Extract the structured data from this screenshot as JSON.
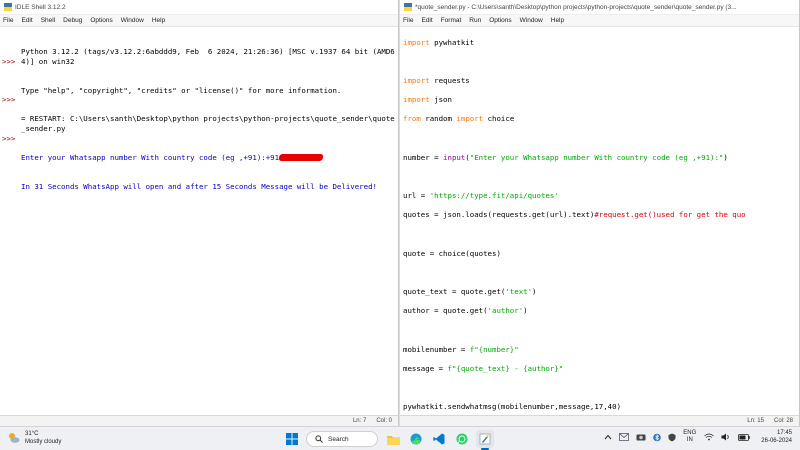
{
  "left_window": {
    "title": "IDLE Shell 3.12.2",
    "menu": [
      "File",
      "Edit",
      "Shell",
      "Debug",
      "Options",
      "Window",
      "Help"
    ],
    "prompts": [
      ">>>",
      ">>>",
      ">>>"
    ],
    "lines": [
      {
        "kind": "out",
        "text": "Python 3.12.2 (tags/v3.12.2:6abddd9, Feb  6 2024, 21:26:36) [MSC v.1937 64 bit (AMD64)] on win32"
      },
      {
        "kind": "out",
        "text": "Type \"help\", \"copyright\", \"credits\" or \"license()\" for more information."
      },
      {
        "kind": "blank",
        "text": ""
      },
      {
        "kind": "out",
        "text": "= RESTART: C:\\Users\\santh\\Desktop\\python projects\\python-projects\\quote_sender\\quote_sender.py"
      },
      {
        "kind": "user",
        "text": "Enter your Whatsapp number With country code (eg ,+91):+91"
      },
      {
        "kind": "user",
        "text": "In 31 Seconds WhatsApp will open and after 15 Seconds Message will be Delivered!"
      }
    ],
    "status": {
      "line": "Ln: 7",
      "col": "Col: 0"
    }
  },
  "right_window": {
    "title": "*quote_sender.py - C:\\Users\\santh\\Desktop\\python projects\\python-projects\\quote_sender\\quote_sender.py (3...",
    "menu": [
      "File",
      "Edit",
      "Format",
      "Run",
      "Options",
      "Window",
      "Help"
    ],
    "code": {
      "l1_kw": "import",
      "l1_rest": " pywhatkit",
      "l3_kw": "import",
      "l3_rest": " requests",
      "l4_kw": "import",
      "l4_rest": " json",
      "l5_kw1": "from",
      "l5_mid": " random ",
      "l5_kw2": "import",
      "l5_rest": " choice",
      "l7_a": "number = ",
      "l7_bi": "input",
      "l7_b": "(",
      "l7_str": "\"Enter your Whatsapp number With country code (eg ,+91):\"",
      "l7_c": ")",
      "l9_a": "url = ",
      "l9_str": "'https://type.fit/api/quotes'",
      "l10_a": "quotes = json.loads(requests.get(url).text)",
      "l10_cm": "#request.get()used for get the quo",
      "l12_a": "quote = choice(quotes)",
      "l14_a": "quote_text = quote.get(",
      "l14_str": "'text'",
      "l14_b": ")",
      "l15_a": "author = quote.get(",
      "l15_str": "'author'",
      "l15_b": ")",
      "l17_a": "mobilenumber = ",
      "l17_str": "f\"{number}\"",
      "l18_a": "message = ",
      "l18_str": "f\"{quote_text} - {author}\"",
      "l20_a": "pywhatkit.sendwhatmsg(mobilenumber,message,17,40)"
    },
    "status": {
      "line": "Ln: 15",
      "col": "Col: 28"
    }
  },
  "taskbar": {
    "weather_temp": "31°C",
    "weather_desc": "Mostly cloudy",
    "search_label": "Search",
    "lang_top": "ENG",
    "lang_bottom": "IN",
    "time": "17:45",
    "date": "26-06-2024"
  }
}
